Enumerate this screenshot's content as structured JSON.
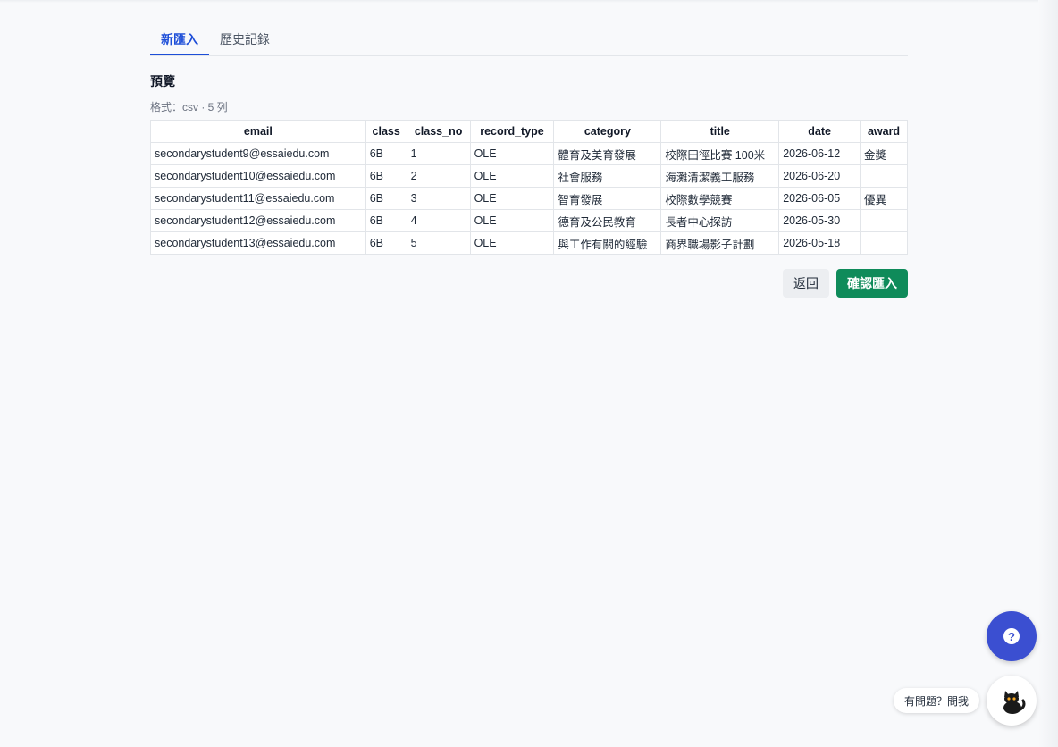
{
  "tabs": [
    {
      "label": "新匯入",
      "active": true
    },
    {
      "label": "歷史記錄",
      "active": false
    }
  ],
  "preview": {
    "title": "預覽",
    "meta": "格式：csv · 5 列"
  },
  "table": {
    "columns": [
      "email",
      "class",
      "class_no",
      "record_type",
      "category",
      "title",
      "date",
      "award"
    ],
    "rows": [
      [
        "secondarystudent9@essaiedu.com",
        "6B",
        "1",
        "OLE",
        "體育及美育發展",
        "校際田徑比賽 100米",
        "2026-06-12",
        "金獎"
      ],
      [
        "secondarystudent10@essaiedu.com",
        "6B",
        "2",
        "OLE",
        "社會服務",
        "海灘清潔義工服務",
        "2026-06-20",
        ""
      ],
      [
        "secondarystudent11@essaiedu.com",
        "6B",
        "3",
        "OLE",
        "智育發展",
        "校際數學競賽",
        "2026-06-05",
        "優異"
      ],
      [
        "secondarystudent12@essaiedu.com",
        "6B",
        "4",
        "OLE",
        "德育及公民教育",
        "長者中心探訪",
        "2026-05-30",
        ""
      ],
      [
        "secondarystudent13@essaiedu.com",
        "6B",
        "5",
        "OLE",
        "與工作有關的經驗",
        "商界職場影子計劃",
        "2026-05-18",
        ""
      ]
    ]
  },
  "actions": {
    "back_label": "返回",
    "confirm_label": "確認匯入"
  },
  "help": {
    "fab_icon": "question-icon",
    "ask_label": "有問題？問我",
    "cat_icon": "cat-mascot-icon"
  },
  "colors": {
    "accent": "#1d4ed8",
    "confirm": "#0f8b5a",
    "help_fab": "#3b4fd1"
  }
}
